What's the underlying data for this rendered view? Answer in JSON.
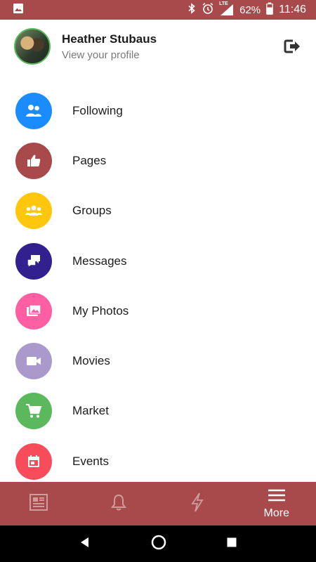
{
  "status_bar": {
    "network_label": "LTE",
    "battery_percent": "62%",
    "time": "11:46",
    "icons": [
      "image-icon",
      "bluetooth-icon",
      "alarm-icon",
      "signal-icon",
      "battery-icon"
    ]
  },
  "profile": {
    "name": "Heather Stubaus",
    "subtitle": "View your profile"
  },
  "menu": {
    "items": [
      {
        "label": "Following",
        "icon": "following-icon",
        "color": "#1a8cff"
      },
      {
        "label": "Pages",
        "icon": "thumbs-up-icon",
        "color": "#a84a4b"
      },
      {
        "label": "Groups",
        "icon": "groups-icon",
        "color": "#fec70d"
      },
      {
        "label": "Messages",
        "icon": "chat-icon",
        "color": "#33208f"
      },
      {
        "label": "My Photos",
        "icon": "photos-icon",
        "color": "#fd5fa2"
      },
      {
        "label": "Movies",
        "icon": "video-camera-icon",
        "color": "#a99acb"
      },
      {
        "label": "Market",
        "icon": "shopping-cart-icon",
        "color": "#5cb85c"
      },
      {
        "label": "Events",
        "icon": "calendar-icon",
        "color": "#f84c5a"
      }
    ]
  },
  "bottom_nav": {
    "more_label": "More",
    "icons": [
      "news-feed-icon",
      "notifications-bell-icon",
      "lightning-icon",
      "menu-icon"
    ]
  },
  "colors": {
    "brand": "#a84a4b"
  }
}
